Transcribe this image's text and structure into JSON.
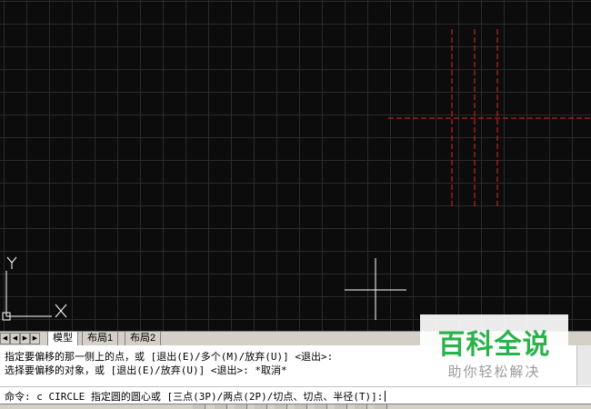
{
  "drawing": {
    "ucs_label_x": "X",
    "ucs_label_y": "Y",
    "colors": {
      "background": "#0c0c0c",
      "grid": "#2a2a2a",
      "centerline": "#e0262a",
      "crosshair": "#ffffff"
    }
  },
  "tabs": {
    "items": [
      {
        "label": "模型",
        "active": true
      },
      {
        "label": "布局1",
        "active": false
      },
      {
        "label": "布局2",
        "active": false
      }
    ]
  },
  "command": {
    "history": [
      "指定要偏移的那一侧上的点，或 [退出(E)/多个(M)/放弃(U)] <退出>:",
      "选择要偏移的对象，或 [退出(E)/放弃(U)] <退出>: *取消*"
    ],
    "prompt": "命令: c CIRCLE 指定圆的圆心或 [三点(3P)/两点(2P)/切点、切点、半径(T)]:"
  },
  "watermark": {
    "title": "百科全说",
    "subtitle": "助你轻松解决"
  }
}
